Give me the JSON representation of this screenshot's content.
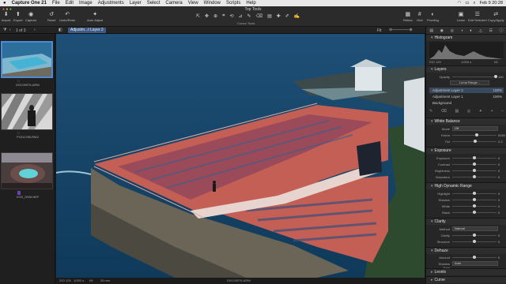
{
  "menubar": {
    "apple": "",
    "app_name": "Capture One 21",
    "items": [
      "File",
      "Edit",
      "Image",
      "Adjustments",
      "Layer",
      "Select",
      "Camera",
      "View",
      "Window",
      "Scripts",
      "Help"
    ],
    "clock": "Feb 9 20:28"
  },
  "toolbar": {
    "title": "Top Tools",
    "left_buttons": [
      {
        "icon": "import-icon",
        "glyph": "⬇",
        "label": "Import"
      },
      {
        "icon": "export-icon",
        "glyph": "⬆",
        "label": "Export"
      },
      {
        "icon": "camera-icon",
        "glyph": "◉",
        "label": "Capture"
      }
    ],
    "mid_buttons": [
      {
        "icon": "reset-icon",
        "glyph": "↺",
        "label": "Reset"
      },
      {
        "icon": "undo-redo-icon",
        "glyph": "↶",
        "label": "Undo/Redo"
      },
      {
        "icon": "auto-adjust-icon",
        "glyph": "✦",
        "label": "Auto Adjust"
      }
    ],
    "cursor_tools_label": "Cursor Tools",
    "right_buttons": [
      {
        "icon": "retina-icon",
        "glyph": "▦",
        "label": "Retina"
      },
      {
        "icon": "grid-icon",
        "glyph": "#",
        "label": "Grid"
      },
      {
        "icon": "proofing-icon",
        "glyph": "◐",
        "label": "Proofing"
      },
      {
        "icon": "learn-icon",
        "glyph": "▣",
        "label": "Learn"
      },
      {
        "icon": "edit-selected-icon",
        "glyph": "☰",
        "label": "Edit Selected"
      },
      {
        "icon": "copy-apply-icon",
        "glyph": "⇄",
        "label": "Copy/Apply"
      }
    ]
  },
  "subbar": {
    "count": "1 of 3",
    "layer_chip": "Adjustm...t Layer 2",
    "zoom": "Fit"
  },
  "filmstrip": {
    "items": [
      {
        "name": "DSC09976.ARW",
        "selected": true
      },
      {
        "name": "P1011785.RW2",
        "selected": false
      },
      {
        "name": "VGS_0926.NEF",
        "selected": false
      }
    ]
  },
  "viewer_status": {
    "iso": "ISO 125",
    "shutter": "1/250 s",
    "aperture": "f/8",
    "focal": "35 mm",
    "filename": "DSC09976.ARW"
  },
  "panel": {
    "histogram": {
      "title": "Histogram",
      "iso": "ISO 125",
      "shutter": "1/250 s",
      "aperture": "f/8"
    },
    "layers": {
      "title": "Layers",
      "opacity_label": "Opacity",
      "opacity_value": "100",
      "luma_label": "Luma Range...",
      "items": [
        {
          "name": "Adjustment Layer 2",
          "value": "100%",
          "selected": true
        },
        {
          "name": "Adjustment Layer 1",
          "value": "100%",
          "selected": false
        },
        {
          "name": "Background",
          "value": "",
          "selected": false
        }
      ]
    },
    "white_balance": {
      "title": "White Balance",
      "mode_label": "Mode",
      "mode_value": "Off",
      "rows": [
        {
          "label": "Kelvin",
          "value": "5150",
          "pos": 0.55
        },
        {
          "label": "Tint",
          "value": "2.2",
          "pos": 0.52
        }
      ]
    },
    "exposure": {
      "title": "Exposure",
      "rows": [
        {
          "label": "Exposure",
          "value": "0",
          "pos": 0.5
        },
        {
          "label": "Contrast",
          "value": "0",
          "pos": 0.5
        },
        {
          "label": "Brightness",
          "value": "0",
          "pos": 0.5
        },
        {
          "label": "Saturation",
          "value": "0",
          "pos": 0.5
        }
      ]
    },
    "hdr": {
      "title": "High Dynamic Range",
      "rows": [
        {
          "label": "Highlight",
          "value": "0",
          "pos": 0.5
        },
        {
          "label": "Shadow",
          "value": "0",
          "pos": 0.5
        },
        {
          "label": "White",
          "value": "0",
          "pos": 0.5
        },
        {
          "label": "Black",
          "value": "0",
          "pos": 0.5
        }
      ]
    },
    "clarity": {
      "title": "Clarity",
      "method_label": "Method",
      "method_value": "Natural",
      "rows": [
        {
          "label": "Clarity",
          "value": "0",
          "pos": 0.5
        },
        {
          "label": "Structure",
          "value": "0",
          "pos": 0.5
        }
      ]
    },
    "dehaze": {
      "title": "Dehaze",
      "rows": [
        {
          "label": "Amount",
          "value": "0",
          "pos": 0.5
        }
      ],
      "shadow_tone_label": "Shadow Tone",
      "shadow_tone_value": "Auto"
    },
    "levels": {
      "title": "Levels"
    },
    "curve": {
      "title": "Curve"
    }
  }
}
